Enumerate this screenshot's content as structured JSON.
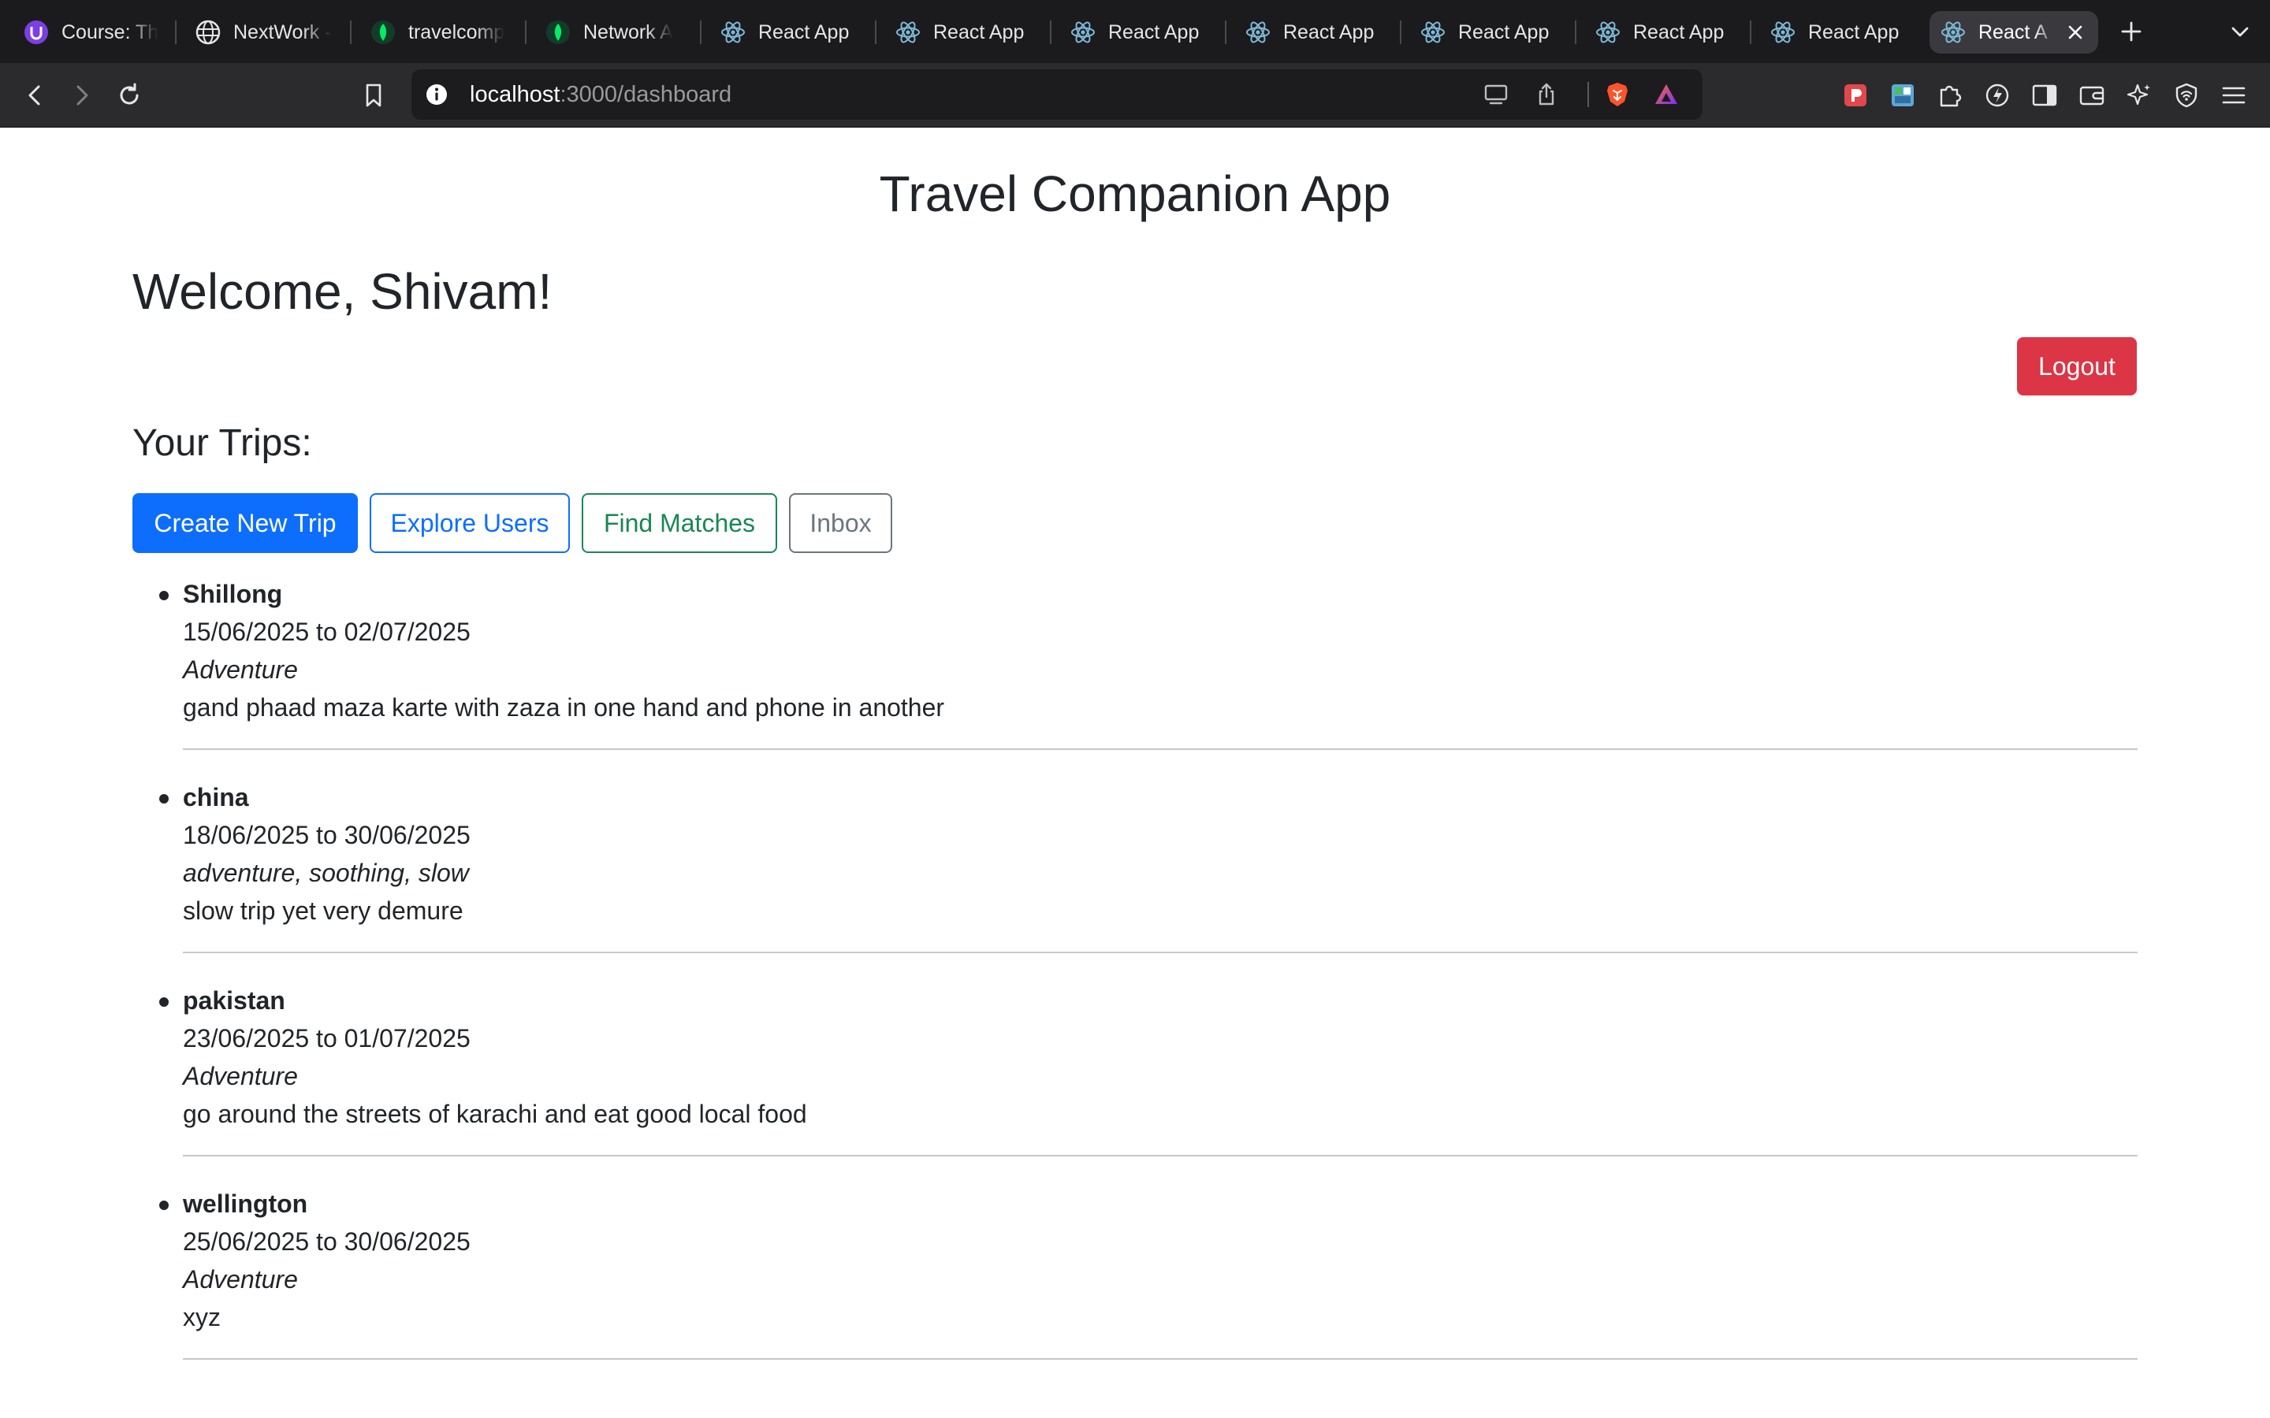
{
  "browser": {
    "tabs": [
      {
        "title": "Course: Th",
        "icon": "university-icon",
        "fade": true
      },
      {
        "title": "NextWork -",
        "icon": "globe-icon",
        "fade": true
      },
      {
        "title": "travelcomp",
        "icon": "mongodb-leaf-icon",
        "fade": true
      },
      {
        "title": "Network A",
        "icon": "mongodb-leaf-icon",
        "fade": true
      },
      {
        "title": "React App",
        "icon": "react-icon",
        "fade": false
      },
      {
        "title": "React App",
        "icon": "react-icon",
        "fade": false
      },
      {
        "title": "React App",
        "icon": "react-icon",
        "fade": false
      },
      {
        "title": "React App",
        "icon": "react-icon",
        "fade": false
      },
      {
        "title": "React App",
        "icon": "react-icon",
        "fade": false
      },
      {
        "title": "React App",
        "icon": "react-icon",
        "fade": false
      },
      {
        "title": "React App",
        "icon": "react-icon",
        "fade": false
      }
    ],
    "active_tab": {
      "title": "React A",
      "icon": "react-icon"
    },
    "url": {
      "host": "localhost",
      "path": ":3000/dashboard"
    },
    "colors": {
      "brave_orange": "#fb542b",
      "tab_bar": "#1b1b1d",
      "toolbar": "#2b2b2d"
    }
  },
  "page": {
    "app_title": "Travel Companion App",
    "welcome": "Welcome, Shivam!",
    "logout_label": "Logout",
    "trips_heading": "Your Trips:",
    "buttons": {
      "create": "Create New Trip",
      "explore": "Explore Users",
      "matches": "Find Matches",
      "inbox": "Inbox"
    },
    "trips": [
      {
        "name": "Shillong",
        "dates": "15/06/2025 to 02/07/2025",
        "type": "Adventure",
        "description": "gand phaad maza karte with zaza in one hand and phone in another"
      },
      {
        "name": "china",
        "dates": "18/06/2025 to 30/06/2025",
        "type": "adventure, soothing, slow",
        "description": "slow trip yet very demure"
      },
      {
        "name": "pakistan",
        "dates": "23/06/2025 to 01/07/2025",
        "type": "Adventure",
        "description": "go around the streets of karachi and eat good local food"
      },
      {
        "name": "wellington",
        "dates": "25/06/2025 to 30/06/2025",
        "type": "Adventure",
        "description": "xyz"
      }
    ],
    "colors": {
      "primary": "#0d6efd",
      "success": "#198754",
      "secondary": "#6c757d",
      "danger": "#dc3545"
    }
  }
}
